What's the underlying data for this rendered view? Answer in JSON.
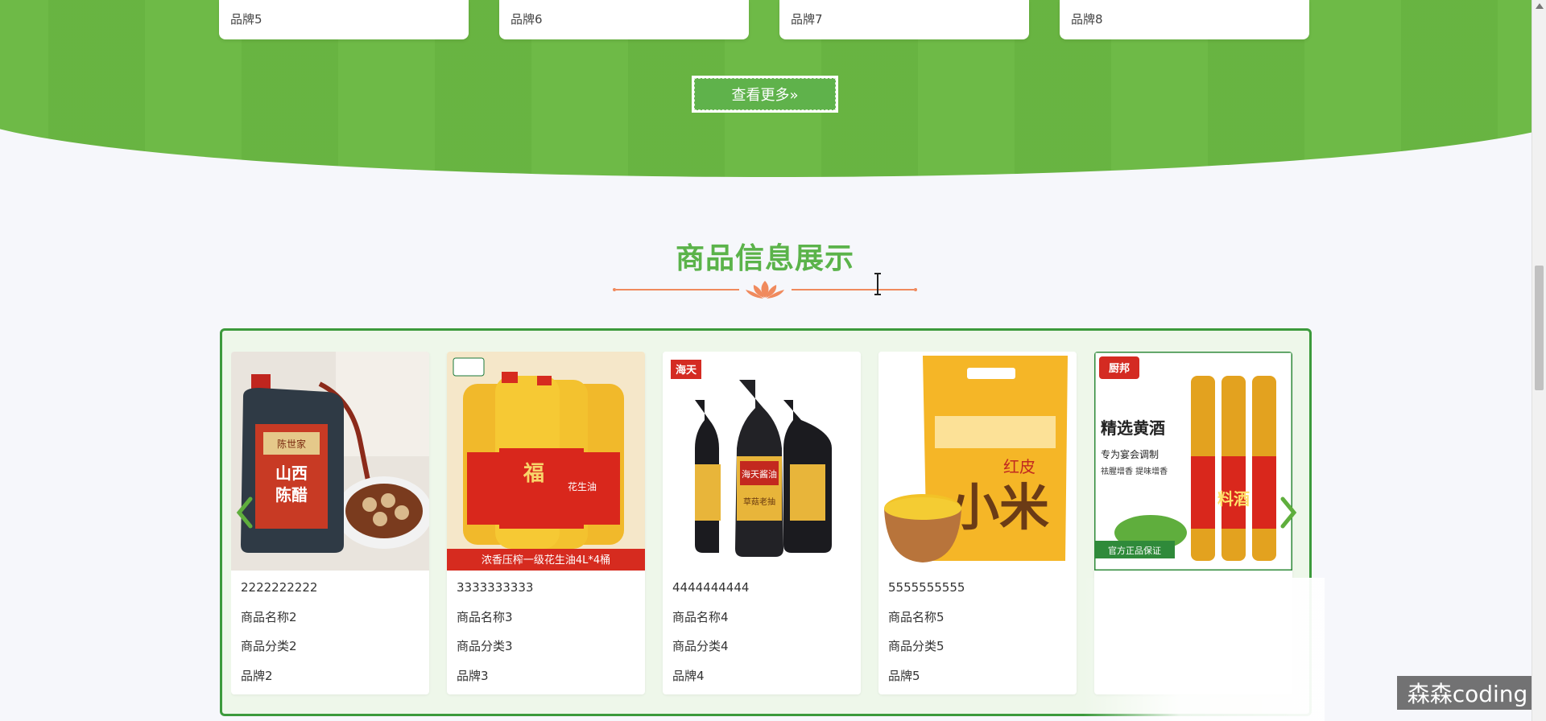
{
  "brands_top": [
    "品牌5",
    "品牌6",
    "品牌7",
    "品牌8"
  ],
  "more_button": {
    "label": "查看更多»"
  },
  "section": {
    "title": "商品信息展示"
  },
  "products": [
    {
      "code": "2222222222",
      "name": "商品名称2",
      "category": "商品分类2",
      "brand": "品牌2",
      "image": {
        "labels": [
          "陈世家",
          "山西",
          "陈醋"
        ]
      }
    },
    {
      "code": "3333333333",
      "name": "商品名称3",
      "category": "商品分类3",
      "brand": "品牌3",
      "image": {
        "labels": [
          "福",
          "花生油",
          "浓香压榨一级花生油4L*4桶"
        ]
      }
    },
    {
      "code": "4444444444",
      "name": "商品名称4",
      "category": "商品分类4",
      "brand": "品牌4",
      "image": {
        "labels": [
          "海天",
          "海天酱油",
          "草菇老抽"
        ]
      }
    },
    {
      "code": "5555555555",
      "name": "商品名称5",
      "category": "商品分类5",
      "brand": "品牌5",
      "image": {
        "labels": [
          "红皮",
          "小米"
        ]
      }
    },
    {
      "code": "",
      "name": "",
      "category": "",
      "brand": "",
      "image": {
        "labels": [
          "厨邦",
          "精选黄酒",
          "专为宴会调制",
          "祛腥增香 提味增香",
          "料酒",
          "官方正品保证"
        ]
      }
    }
  ],
  "watermark": "森森coding",
  "colors": {
    "green": "#6bb843",
    "title_green": "#5bb34a",
    "border_green": "#3c9a3c",
    "divider_orange": "#f08a5d"
  }
}
